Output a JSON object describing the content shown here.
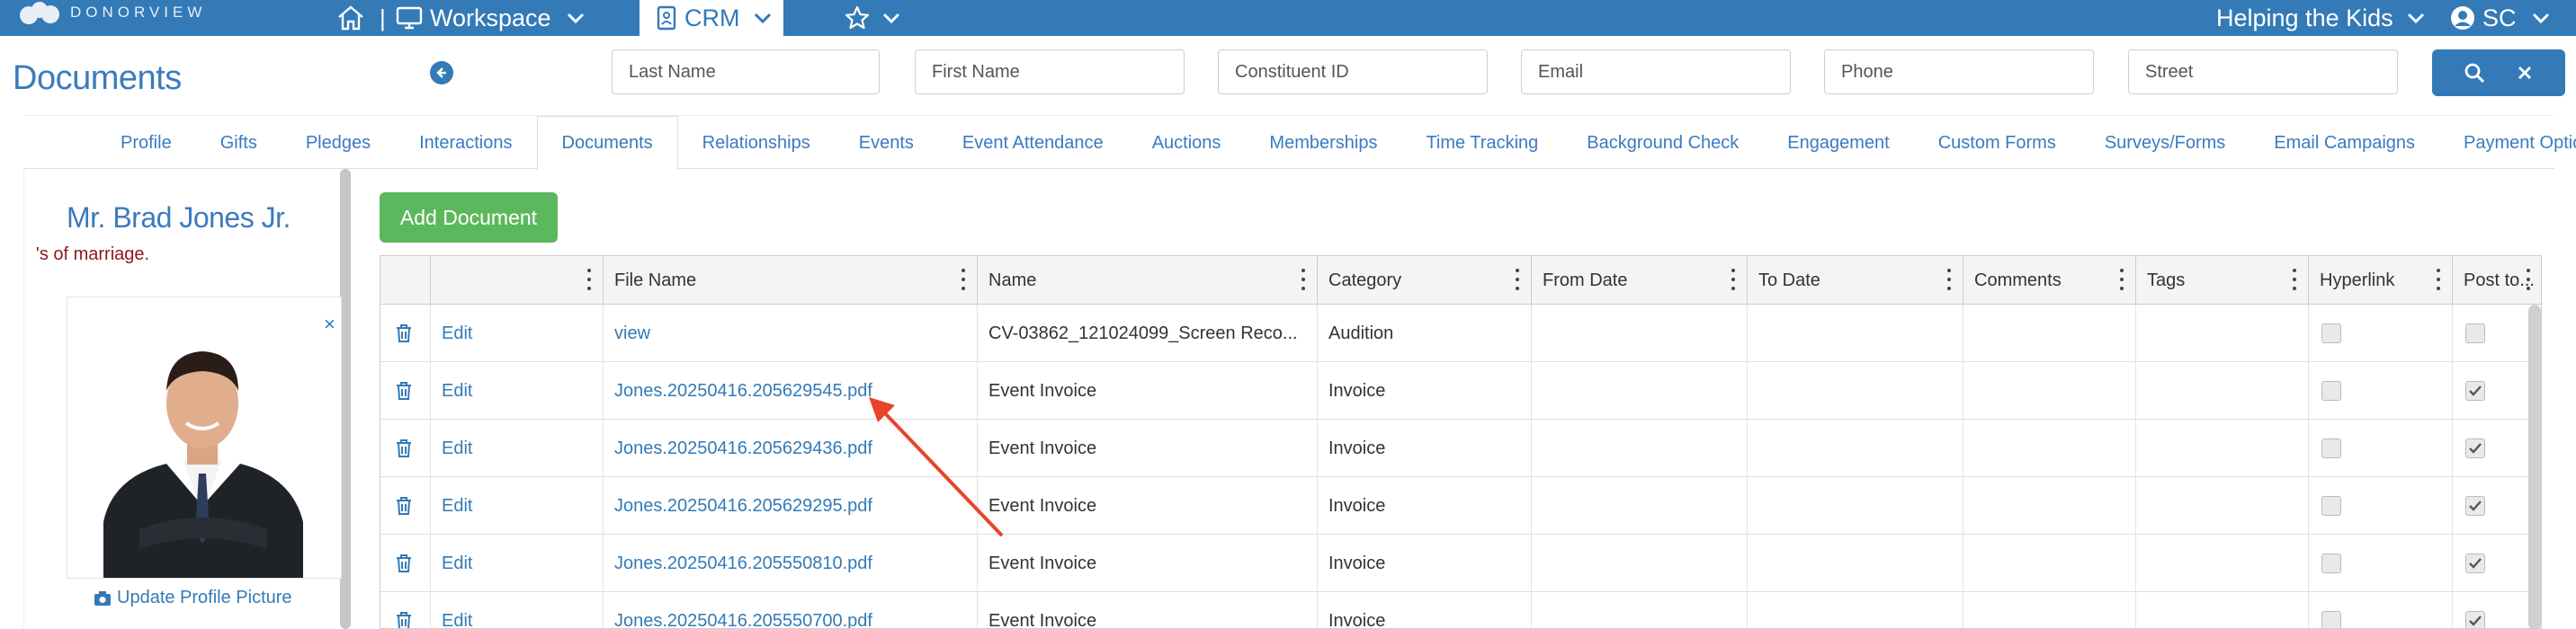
{
  "topbar": {
    "brand": "DONORVIEW",
    "workspace_label": "Workspace",
    "crm_label": "CRM",
    "org_name": "Helping the Kids",
    "user_initials": "SC",
    "icons": [
      "logo-icon",
      "home-icon",
      "monitor-icon",
      "chevron-down-icon",
      "contact-card-icon",
      "star-icon",
      "user-circle-icon"
    ]
  },
  "header": {
    "title": "Documents",
    "search_fields": [
      {
        "placeholder": "Last Name"
      },
      {
        "placeholder": "First Name"
      },
      {
        "placeholder": "Constituent ID"
      },
      {
        "placeholder": "Email"
      },
      {
        "placeholder": "Phone"
      },
      {
        "placeholder": "Street"
      }
    ]
  },
  "tabs": [
    "Profile",
    "Gifts",
    "Pledges",
    "Interactions",
    "Documents",
    "Relationships",
    "Events",
    "Event Attendance",
    "Auctions",
    "Memberships",
    "Time Tracking",
    "Background Check",
    "Engagement",
    "Custom Forms",
    "Surveys/Forms",
    "Email Campaigns",
    "Payment Options"
  ],
  "active_tab": "Documents",
  "profile": {
    "name": "Mr. Brad Jones Jr.",
    "bio_snippet": "'s of marriage.",
    "update_picture_label": "Update Profile Picture"
  },
  "documents": {
    "add_button": "Add Document",
    "columns": [
      "",
      "",
      "File Name",
      "Name",
      "Category",
      "From Date",
      "To Date",
      "Comments",
      "Tags",
      "Hyperlink",
      "Post to..."
    ],
    "rows": [
      {
        "edit": "Edit",
        "file_name": "view",
        "name": "CV-03862_121024099_Screen Reco...",
        "category": "Audition",
        "hyperlink": false,
        "post": false
      },
      {
        "edit": "Edit",
        "file_name": "Jones.20250416.205629545.pdf",
        "name": "Event Invoice",
        "category": "Invoice",
        "hyperlink": false,
        "post": true
      },
      {
        "edit": "Edit",
        "file_name": "Jones.20250416.205629436.pdf",
        "name": "Event Invoice",
        "category": "Invoice",
        "hyperlink": false,
        "post": true
      },
      {
        "edit": "Edit",
        "file_name": "Jones.20250416.205629295.pdf",
        "name": "Event Invoice",
        "category": "Invoice",
        "hyperlink": false,
        "post": true
      },
      {
        "edit": "Edit",
        "file_name": "Jones.20250416.205550810.pdf",
        "name": "Event Invoice",
        "category": "Invoice",
        "hyperlink": false,
        "post": true
      },
      {
        "edit": "Edit",
        "file_name": "Jones.20250416.205550700.pdf",
        "name": "Event Invoice",
        "category": "Invoice",
        "hyperlink": false,
        "post": true
      }
    ]
  },
  "colors": {
    "primary": "#337ab7",
    "success": "#5cb85c",
    "annotation_arrow": "#e8442c",
    "bio_text": "#8b1a1a"
  }
}
